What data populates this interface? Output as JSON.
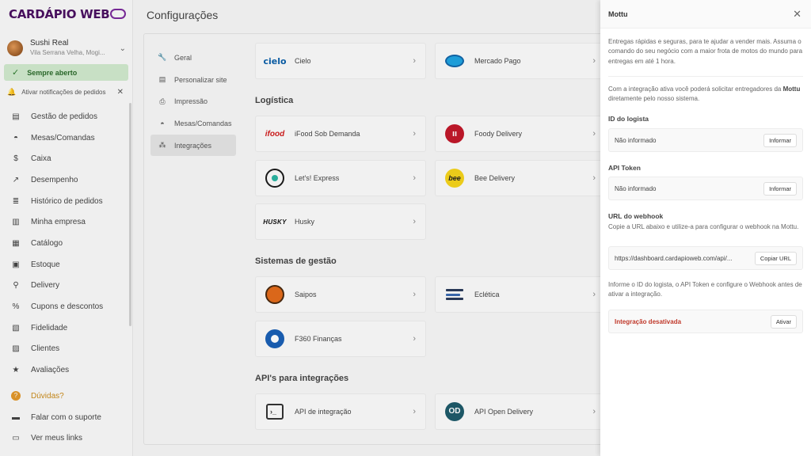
{
  "app": {
    "logo_text": "CARDÁPIO WEB",
    "store_name": "Sushi Real",
    "store_address": "Vila Serrana Velha, Mogi...",
    "open_status": "Sempre aberto",
    "notifications_label": "Ativar notificações de pedidos"
  },
  "sidebar": {
    "items": [
      {
        "label": "Gestão de pedidos",
        "icon": "orders-icon"
      },
      {
        "label": "Mesas/Comandas",
        "icon": "tables-icon"
      },
      {
        "label": "Caixa",
        "icon": "cash-icon"
      },
      {
        "label": "Desempenho",
        "icon": "performance-icon"
      },
      {
        "label": "Histórico de pedidos",
        "icon": "history-icon"
      },
      {
        "label": "Minha empresa",
        "icon": "company-icon"
      },
      {
        "label": "Catálogo",
        "icon": "catalog-icon"
      },
      {
        "label": "Estoque",
        "icon": "stock-icon"
      },
      {
        "label": "Delivery",
        "icon": "delivery-icon"
      },
      {
        "label": "Cupons e descontos",
        "icon": "coupons-icon"
      },
      {
        "label": "Fidelidade",
        "icon": "loyalty-icon"
      },
      {
        "label": "Clientes",
        "icon": "clients-icon"
      },
      {
        "label": "Avaliações",
        "icon": "star-icon"
      }
    ],
    "bottom": [
      {
        "label": "Dúvidas?",
        "icon": "help-icon"
      },
      {
        "label": "Falar com o suporte",
        "icon": "support-icon"
      },
      {
        "label": "Ver meus links",
        "icon": "links-icon"
      }
    ]
  },
  "page": {
    "title": "Configurações"
  },
  "settings_nav": [
    {
      "label": "Geral",
      "icon": "wrench-icon"
    },
    {
      "label": "Personalizar site",
      "icon": "site-icon"
    },
    {
      "label": "Impressão",
      "icon": "printer-icon"
    },
    {
      "label": "Mesas/Comandas",
      "icon": "tables-icon"
    },
    {
      "label": "Integrações",
      "icon": "integrations-icon"
    }
  ],
  "sections": {
    "logistica": "Logística",
    "gestao": "Sistemas de gestão",
    "apis": "API's para integrações"
  },
  "integrations": {
    "cielo": {
      "name": "Cielo",
      "logo": "cielo"
    },
    "mercado_pago": {
      "name": "Mercado Pago"
    },
    "ifood": {
      "name": "iFood Sob Demanda",
      "logo": "ifood"
    },
    "foody": {
      "name": "Foody Delivery"
    },
    "lets": {
      "name": "Let's! Express"
    },
    "bee": {
      "name": "Bee Delivery",
      "logo": "bee"
    },
    "husky": {
      "name": "Husky",
      "logo": "HUSKY"
    },
    "saipos": {
      "name": "Saipos"
    },
    "ecletica": {
      "name": "Eclética"
    },
    "f360": {
      "name": "F360 Finanças"
    },
    "api": {
      "name": "API de integração"
    },
    "open_delivery": {
      "name": "API Open Delivery",
      "logo": "OD"
    }
  },
  "drawer": {
    "title": "Mottu",
    "intro": "Entregas rápidas e seguras, para te ajudar a vender mais. Assuma o comando do seu negócio com a maior frota de motos do mundo para entregas em até 1 hora.",
    "info_prefix": "Com a integração ativa você poderá solicitar entregadores da ",
    "info_bold": "Mottu",
    "info_suffix": " diretamente pelo nosso sistema.",
    "store_id_label": "ID do logista",
    "store_id_value": "Não informado",
    "store_id_button": "Informar",
    "token_label": "API Token",
    "token_value": "Não informado",
    "token_button": "Informar",
    "webhook_label": "URL do webhook",
    "webhook_help": "Copie a URL abaixo e utilize-a para configurar o webhook na Mottu.",
    "webhook_value": "https://dashboard.cardapioweb.com/api/...",
    "webhook_button": "Copiar URL",
    "footer_help": "Informe o ID do logista, o API Token e configure o Webhook antes de ativar a integração.",
    "status_value": "Integração desativada",
    "status_button": "Ativar"
  },
  "colors": {
    "open_bg": "#cfe8cc",
    "status_red": "#c0392b",
    "help_orange": "#e0962a"
  }
}
